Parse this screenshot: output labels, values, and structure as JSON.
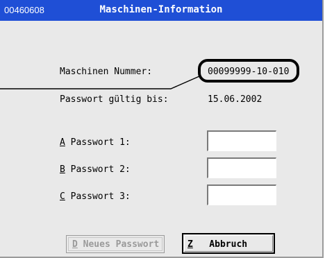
{
  "window": {
    "id": "00460608",
    "title": "Maschinen-Information"
  },
  "fields": {
    "machine_number_label": "Maschinen Nummer:",
    "machine_number_value": "00099999-10-010",
    "password_valid_label": "Passwort gültig bis:",
    "password_valid_value": "15.06.2002"
  },
  "passwords": [
    {
      "hotkey": "A",
      "label": " Passwort 1:",
      "value": ""
    },
    {
      "hotkey": "B",
      "label": " Passwort 2:",
      "value": ""
    },
    {
      "hotkey": "C",
      "label": " Passwort 3:",
      "value": ""
    }
  ],
  "buttons": {
    "new_password": {
      "hotkey": "D",
      "label": " Neues Passwort"
    },
    "cancel": {
      "hotkey": "Z",
      "label": "   Abbruch"
    }
  },
  "colors": {
    "titlebar": "#1f4fd6",
    "window_bg": "#e9e9e9"
  }
}
